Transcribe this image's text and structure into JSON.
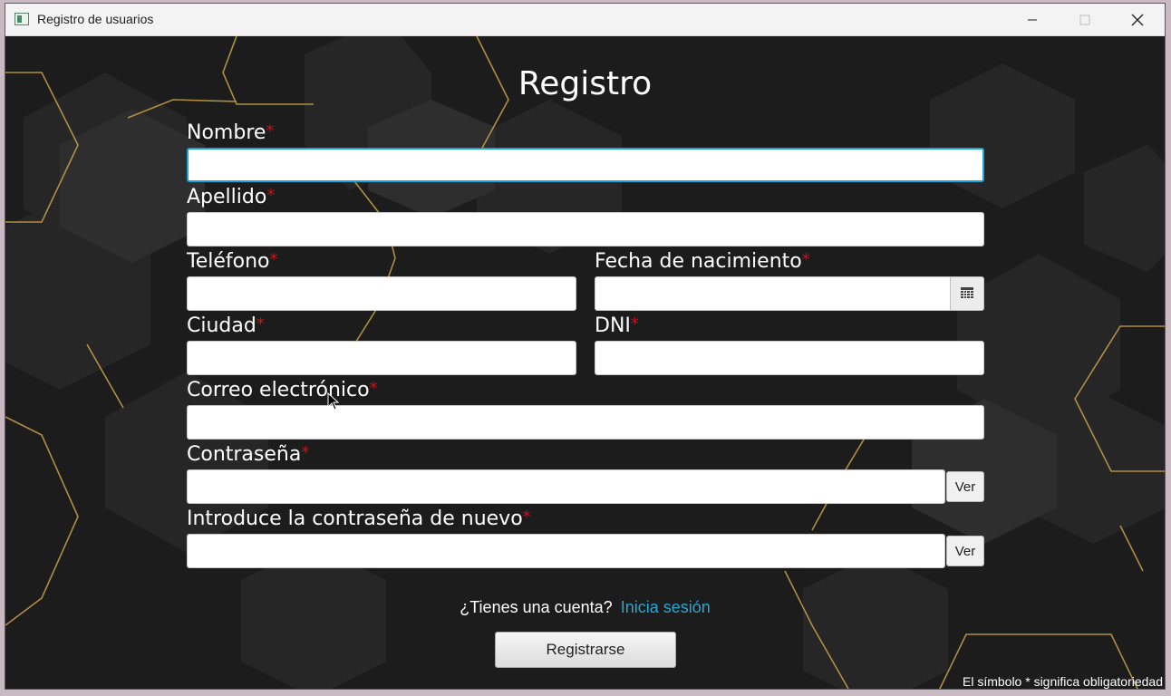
{
  "window": {
    "title": "Registro de usuarios",
    "minimize_icon": "minimize-icon",
    "maximize_icon": "maximize-icon",
    "close_icon": "close-icon"
  },
  "form": {
    "heading": "Registro",
    "required_mark": "*",
    "nombre": {
      "label": "Nombre",
      "value": ""
    },
    "apellido": {
      "label": "Apellido",
      "value": ""
    },
    "telefono": {
      "label": "Teléfono",
      "value": ""
    },
    "fecha_nacimiento": {
      "label": "Fecha de nacimiento",
      "value": "",
      "icon": "calendar-icon"
    },
    "ciudad": {
      "label": "Ciudad",
      "value": ""
    },
    "dni": {
      "label": "DNI",
      "value": ""
    },
    "correo": {
      "label": "Correo electrónico",
      "value": ""
    },
    "contrasena": {
      "label": "Contraseña",
      "value": "",
      "toggle_label": "Ver"
    },
    "contrasena_repetir": {
      "label": "Introduce la contraseña de nuevo",
      "value": "",
      "toggle_label": "Ver"
    }
  },
  "footer": {
    "have_account_text": "¿Tienes una cuenta?",
    "login_link": "Inicia sesión",
    "register_button": "Registrarse",
    "required_note": "El símbolo * significa obligatoriedad"
  },
  "colors": {
    "background": "#1c1c1c",
    "accent_gold": "#c9a24a",
    "required_red": "#c4141b",
    "link_blue": "#26a7d4",
    "focus_border": "#1aa3d4"
  }
}
